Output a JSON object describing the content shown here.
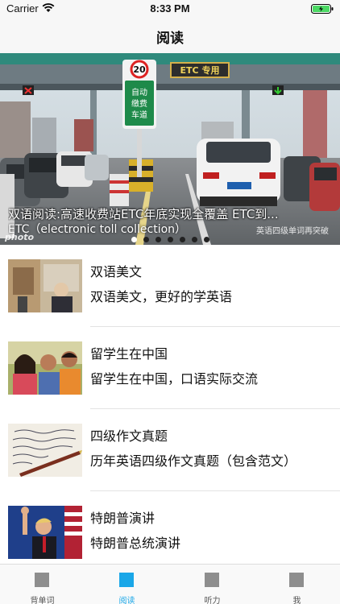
{
  "status_bar": {
    "carrier": "Carrier",
    "time": "8:33 PM",
    "wifi_icon": "wifi-icon",
    "battery_icon": "battery-charging-icon"
  },
  "nav": {
    "title": "阅读"
  },
  "banner": {
    "caption": "双语阅读:高速收费站ETC年底实现全覆盖 ETC到...",
    "caption_line2": "ETC（electronic toll collection）",
    "watermark_left": "photo",
    "watermark_right": "英语四级单词再突破",
    "page_count": 7,
    "active_page": 0,
    "sign_speed": "20",
    "sign_lane_text": "自动缴费车道",
    "sign_etc": "ETC 专用"
  },
  "list": [
    {
      "title": "双语美文",
      "subtitle": "双语美文，更好的学英语",
      "thumb": "museum-photo"
    },
    {
      "title": "留学生在中国",
      "subtitle": "留学生在中国，口语实际交流",
      "thumb": "students-photo"
    },
    {
      "title": "四级作文真题",
      "subtitle": "历年英语四级作文真题（包含范文）",
      "thumb": "handwriting-photo"
    },
    {
      "title": "特朗普演讲",
      "subtitle": "特朗普总统演讲",
      "thumb": "trump-speech-photo"
    }
  ],
  "tabs": [
    {
      "label": "背单词",
      "icon": "vocabulary-icon",
      "active": false
    },
    {
      "label": "阅读",
      "icon": "reading-icon",
      "active": true
    },
    {
      "label": "听力",
      "icon": "listening-icon",
      "active": false
    },
    {
      "label": "我",
      "icon": "profile-icon",
      "active": false
    }
  ],
  "colors": {
    "accent": "#1aa7e8",
    "tab_inactive": "#8e8e8e",
    "separator": "#e3e3e3"
  }
}
